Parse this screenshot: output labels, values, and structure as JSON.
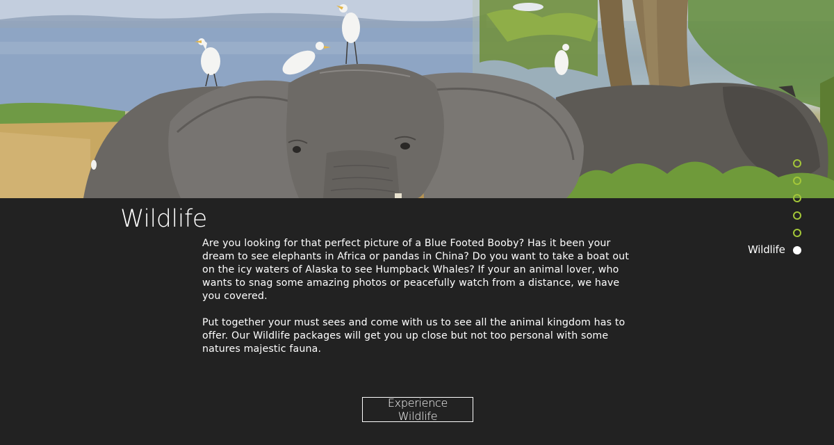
{
  "section": {
    "title": "Wildlife",
    "paragraphs": [
      "Are you looking for that perfect picture of a Blue Footed Booby? Has it been your dream to see elephants in Africa or pandas in China? Do you want to take a boat out on the icy waters of Alaska to see Humpback Whales? If your an animal lover, who wants to snag some amazing photos or peacefully watch from a distance, we have you covered.",
      "Put together your must sees and come with us to see all the animal kingdom has to offer. Our Wildlife packages will get you up close but not too personal with some natures majestic fauna."
    ],
    "cta_label": "Experience Wildlife"
  },
  "side_nav": {
    "active_label": "Wildlife",
    "dot_color": "#a4c739",
    "active_dot_color": "#ffffff",
    "dots": [
      {
        "active": false
      },
      {
        "active": false
      },
      {
        "active": false
      },
      {
        "active": false
      },
      {
        "active": false
      },
      {
        "active": true
      }
    ]
  },
  "hero": {
    "image": "elephant-with-egrets-photo"
  },
  "colors": {
    "background": "#222222",
    "text": "#ffffff"
  }
}
